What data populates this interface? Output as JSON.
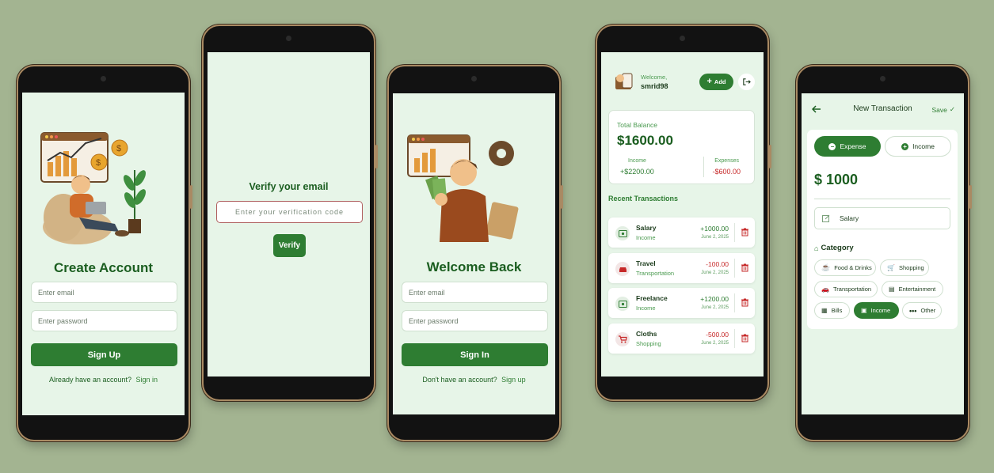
{
  "signup": {
    "title": "Create Account",
    "email_placeholder": "Enter email",
    "password_placeholder": "Enter password",
    "button": "Sign Up",
    "footer_text": "Already have an account?",
    "footer_link": "Sign in"
  },
  "verify": {
    "title": "Verify your email",
    "code_placeholder": "Enter your verification code",
    "button": "Verify"
  },
  "signin": {
    "title": "Welcome Back",
    "email_placeholder": "Enter email",
    "password_placeholder": "Enter password",
    "button": "Sign In",
    "footer_text": "Don't have an account?",
    "footer_link": "Sign up"
  },
  "dashboard": {
    "welcome": "Welcome,",
    "username": "smrid98",
    "add_button": "Add",
    "balance_label": "Total Balance",
    "balance": "$1600.00",
    "income_label": "Income",
    "income": "+$2200.00",
    "expenses_label": "Expenses",
    "expenses": "-$600.00",
    "recent_title": "Recent Transactions",
    "transactions": [
      {
        "name": "Salary",
        "category": "Income",
        "amount": "+1000.00",
        "date": "June 2, 2025",
        "type": "income",
        "icon": "cash-icon"
      },
      {
        "name": "Travel",
        "category": "Transportation",
        "amount": "-100.00",
        "date": "June 2, 2025",
        "type": "expense",
        "icon": "car-icon"
      },
      {
        "name": "Freelance",
        "category": "Income",
        "amount": "+1200.00",
        "date": "June 2, 2025",
        "type": "income",
        "icon": "cash-icon"
      },
      {
        "name": "Cloths",
        "category": "Shopping",
        "amount": "-500.00",
        "date": "June 2, 2025",
        "type": "expense",
        "icon": "cart-icon"
      }
    ]
  },
  "new_txn": {
    "title": "New Transaction",
    "save": "Save",
    "expense_tab": "Expense",
    "income_tab": "Income",
    "amount": "$ 1000",
    "note": "Salary",
    "category_label": "Category",
    "categories": [
      {
        "label": "Food & Drinks",
        "selected": false
      },
      {
        "label": "Shopping",
        "selected": false
      },
      {
        "label": "Transportation",
        "selected": false
      },
      {
        "label": "Entertainment",
        "selected": false
      },
      {
        "label": "Bills",
        "selected": false
      },
      {
        "label": "Income",
        "selected": true
      },
      {
        "label": "Other",
        "selected": false
      }
    ]
  },
  "colors": {
    "background": "#a3b491",
    "screen": "#e7f5e8",
    "primary": "#2e7d32",
    "expense": "#c62828"
  }
}
